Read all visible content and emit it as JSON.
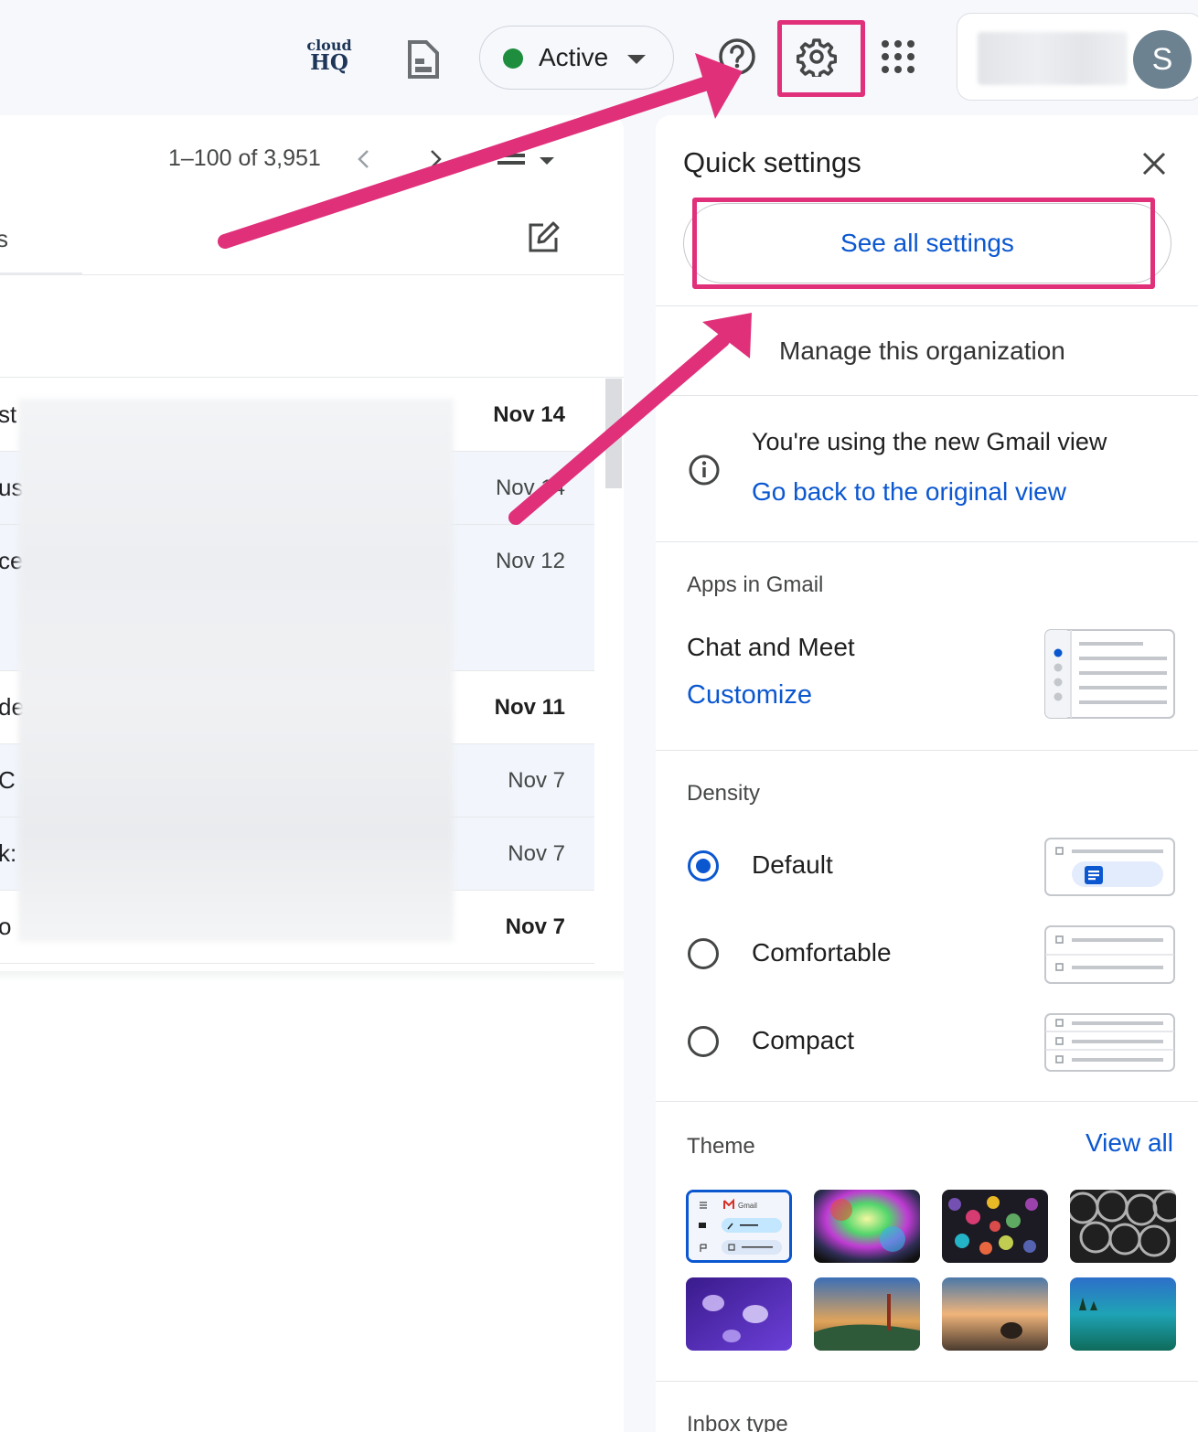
{
  "topbar": {
    "cloudhq_line1": "cloud",
    "cloudhq_line2": "HQ",
    "status_label": "Active",
    "avatar_initial": "S"
  },
  "mail_list": {
    "pagination": "1–100 of 3,951",
    "tab_fragment": "s",
    "rows": [
      {
        "frag": "st",
        "date": "Nov 14",
        "unread": true
      },
      {
        "frag": "us",
        "date": "Nov 14",
        "unread": false
      },
      {
        "frag": "ce",
        "date": "Nov 12",
        "unread": false
      },
      {
        "frag": "de",
        "date": "Nov 11",
        "unread": true
      },
      {
        "frag": "C",
        "date": "Nov 7",
        "unread": false
      },
      {
        "frag": "k:",
        "date": "Nov 7",
        "unread": false
      },
      {
        "frag": "o",
        "date": "Nov 7",
        "unread": true
      }
    ]
  },
  "quick_settings": {
    "title": "Quick settings",
    "see_all": "See all settings",
    "manage_org": "Manage this organization",
    "gmail_view_notice": "You're using the new Gmail view",
    "go_back_link": "Go back to the original view",
    "apps_heading": "Apps in Gmail",
    "chat_meet": "Chat and Meet",
    "customize": "Customize",
    "density_heading": "Density",
    "density_options": [
      {
        "label": "Default",
        "selected": true
      },
      {
        "label": "Comfortable",
        "selected": false
      },
      {
        "label": "Compact",
        "selected": false
      }
    ],
    "theme_heading": "Theme",
    "view_all": "View all",
    "default_theme_label": "Gmail",
    "inbox_type_heading": "Inbox type"
  },
  "colors": {
    "accent_blue": "#0b57d0",
    "annotation_pink": "#e0307a",
    "status_green": "#1e8e3e"
  },
  "icons": [
    "cloudhq-logo",
    "document-icon",
    "help-icon",
    "gear-icon",
    "apps-grid-icon",
    "chevron-left-icon",
    "chevron-right-icon",
    "view-toggle-icon",
    "compose-icon",
    "close-icon",
    "info-icon"
  ]
}
